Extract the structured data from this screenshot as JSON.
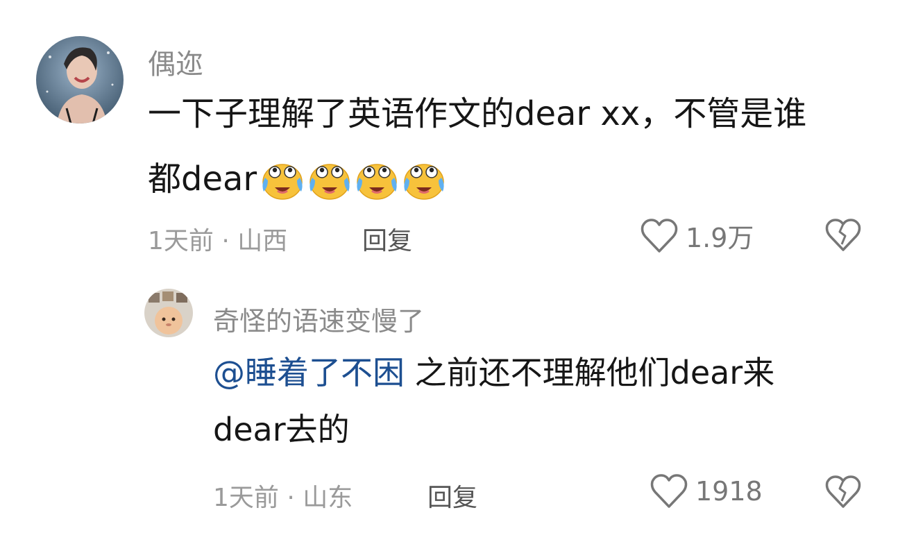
{
  "comments": [
    {
      "username": "偶迩",
      "text_line1": "一下子理解了英语作文的dear xx，不管是谁",
      "text_line2_prefix": "都dear",
      "emoji_name": "crying-laughing-emoji",
      "emoji_count": 4,
      "meta": "1天前 · 山西",
      "reply_label": "回复",
      "like_count": "1.9万"
    },
    {
      "username": "奇怪的语速变慢了",
      "mention": "@睡着了不困",
      "text_line1_rest": " 之前还不理解他们dear来",
      "text_line2": "dear去的",
      "meta": "1天前 · 山东",
      "reply_label": "回复",
      "like_count": "1918"
    }
  ],
  "icons": {
    "like": "heart-outline-icon",
    "dislike": "broken-heart-icon"
  },
  "colors": {
    "username": "#8a8a8a",
    "body": "#161616",
    "mention": "#1d4f91",
    "meta": "#9a9a9a",
    "icon": "#777777"
  }
}
